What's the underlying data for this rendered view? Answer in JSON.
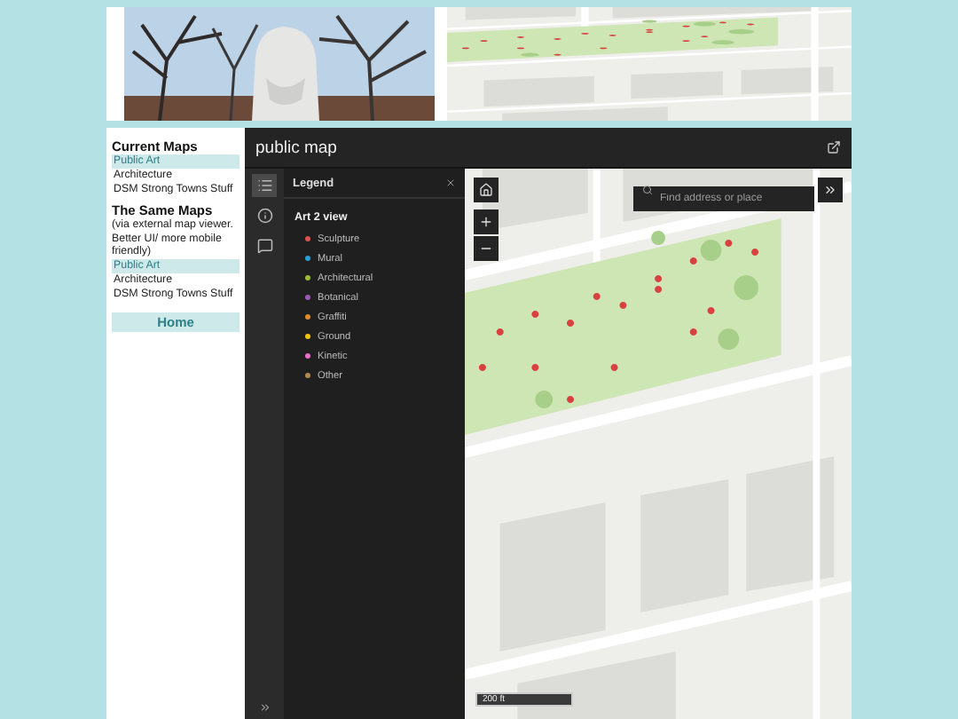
{
  "sidebar": {
    "sections": [
      {
        "title": "Current Maps",
        "items": [
          {
            "label": "Public Art",
            "selected": true
          },
          {
            "label": "Architecture",
            "selected": false
          },
          {
            "label": "DSM Strong Towns Stuff",
            "selected": false
          }
        ]
      },
      {
        "title": "The Same Maps",
        "note": "(via external map viewer. Better UI/ more mobile friendly)",
        "items": [
          {
            "label": "Public Art",
            "selected": true
          },
          {
            "label": "Architecture",
            "selected": false
          },
          {
            "label": "DSM Strong Towns Stuff",
            "selected": false
          }
        ]
      }
    ],
    "home_button": "Home"
  },
  "app": {
    "title": "public map",
    "rail": [
      {
        "kind": "legend",
        "selected": true
      },
      {
        "kind": "info",
        "selected": false
      },
      {
        "kind": "comment",
        "selected": false
      }
    ],
    "legend": {
      "title": "Legend",
      "layer": "Art 2 view",
      "items": [
        {
          "label": "Sculpture",
          "color": "#d9534f"
        },
        {
          "label": "Mural",
          "color": "#2a9fd6"
        },
        {
          "label": "Architectural",
          "color": "#9bbb3a"
        },
        {
          "label": "Botanical",
          "color": "#9b59b6"
        },
        {
          "label": "Graffiti",
          "color": "#e08a2e"
        },
        {
          "label": "Ground",
          "color": "#f1c40f"
        },
        {
          "label": "Kinetic",
          "color": "#e56fc7"
        },
        {
          "label": "Other",
          "color": "#b08850"
        }
      ]
    },
    "search": {
      "placeholder": "Find address or place"
    },
    "scale": "200 ft"
  }
}
